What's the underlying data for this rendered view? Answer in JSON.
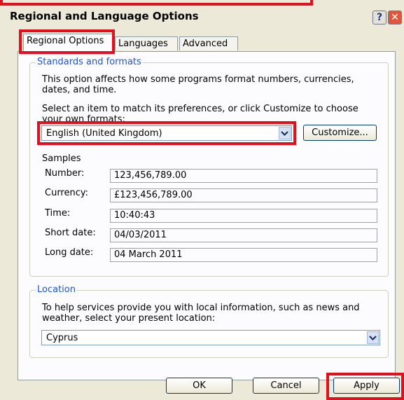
{
  "window": {
    "title": "Regional and Language Options",
    "help_glyph": "?",
    "close_glyph": "✕"
  },
  "tabs": [
    {
      "label": "Regional Options",
      "active": true
    },
    {
      "label": "Languages",
      "active": false
    },
    {
      "label": "Advanced",
      "active": false
    }
  ],
  "standards": {
    "legend": "Standards and formats",
    "description_line1": "This option affects how some programs format numbers, currencies,",
    "description_line2": "dates, and time.",
    "instruction_line1": "Select an item to match its preferences, or click Customize to choose",
    "instruction_line2": "your own formats:",
    "selected_locale": "English (United Kingdom)",
    "customize_label": "Customize..."
  },
  "samples": {
    "heading": "Samples",
    "rows": [
      {
        "label": "Number:",
        "value": "123,456,789.00"
      },
      {
        "label": "Currency:",
        "value": "£123,456,789.00"
      },
      {
        "label": "Time:",
        "value": "10:40:43"
      },
      {
        "label": "Short date:",
        "value": "04/03/2011"
      },
      {
        "label": "Long date:",
        "value": "04 March 2011"
      }
    ]
  },
  "location": {
    "legend": "Location",
    "description_line1": "To help services provide you with local information, such as news and",
    "description_line2": "weather, select your present location:",
    "selected": "Cyprus"
  },
  "buttons": {
    "ok": "OK",
    "cancel": "Cancel",
    "apply": "Apply"
  },
  "colors": {
    "highlight": "#e2101d",
    "legend_text": "#1a56d5",
    "dialog_bg": "#ece9d8"
  }
}
